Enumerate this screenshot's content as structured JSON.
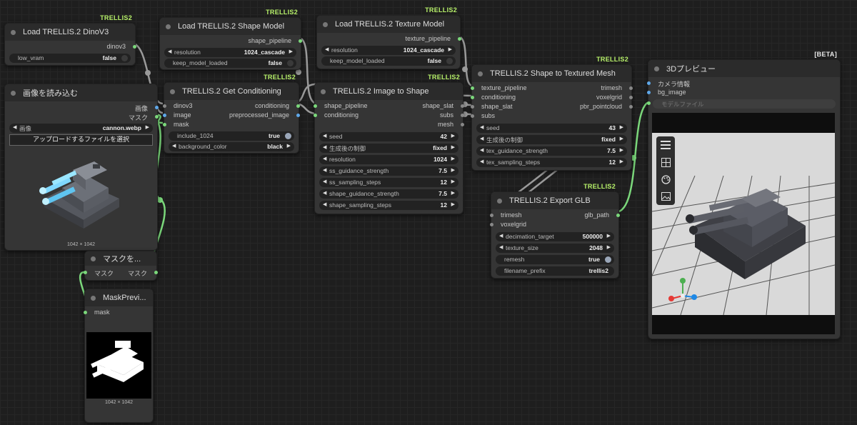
{
  "badges": {
    "trellis": "TRELLIS2",
    "beta": "[BETA]"
  },
  "nodes": {
    "dinov3": {
      "title": "Load TRELLIS.2 DinoV3",
      "output": "dinov3",
      "widget_label": "low_vram",
      "widget_value": "false"
    },
    "shape_model": {
      "title": "Load TRELLIS.2 Shape Model",
      "output": "shape_pipeline",
      "resolution_label": "resolution",
      "resolution_value": "1024_cascade",
      "keep_label": "keep_model_loaded",
      "keep_value": "false"
    },
    "texture_model": {
      "title": "Load TRELLIS.2 Texture Model",
      "output": "texture_pipeline",
      "resolution_label": "resolution",
      "resolution_value": "1024_cascade",
      "keep_label": "keep_model_loaded",
      "keep_value": "false"
    },
    "load_image": {
      "title": "画像を読み込む",
      "out_image": "画像",
      "out_mask": "マスク",
      "image_label": "画像",
      "image_value": "cannon.webp",
      "upload_label": "アップロードするファイルを選択",
      "caption": "1042 × 1042"
    },
    "conditioning": {
      "title": "TRELLIS.2 Get Conditioning",
      "in_dinov3": "dinov3",
      "in_image": "image",
      "in_mask": "mask",
      "out_conditioning": "conditioning",
      "out_preprocessed": "preprocessed_image",
      "include_label": "include_1024",
      "include_value": "true",
      "bg_label": "background_color",
      "bg_value": "black"
    },
    "image_to_shape": {
      "title": "TRELLIS.2 Image to Shape",
      "in_shape_pipeline": "shape_pipeline",
      "in_conditioning": "conditioning",
      "out_shape_slat": "shape_slat",
      "out_subs": "subs",
      "out_mesh": "mesh",
      "widgets": [
        {
          "label": "seed",
          "value": "42"
        },
        {
          "label": "生成後の制御",
          "value": "fixed"
        },
        {
          "label": "resolution",
          "value": "1024"
        },
        {
          "label": "ss_guidance_strength",
          "value": "7.5"
        },
        {
          "label": "ss_sampling_steps",
          "value": "12"
        },
        {
          "label": "shape_guidance_strength",
          "value": "7.5"
        },
        {
          "label": "shape_sampling_steps",
          "value": "12"
        }
      ]
    },
    "textured_mesh": {
      "title": "TRELLIS.2 Shape to Textured Mesh",
      "in_texture_pipeline": "texture_pipeline",
      "in_conditioning": "conditioning",
      "in_shape_slat": "shape_slat",
      "in_subs": "subs",
      "out_trimesh": "trimesh",
      "out_voxelgrid": "voxelgrid",
      "out_pbr": "pbr_pointcloud",
      "widgets": [
        {
          "label": "seed",
          "value": "43"
        },
        {
          "label": "生成後の制御",
          "value": "fixed"
        },
        {
          "label": "tex_guidance_strength",
          "value": "7.5"
        },
        {
          "label": "tex_sampling_steps",
          "value": "12"
        }
      ]
    },
    "export_glb": {
      "title": "TRELLIS.2 Export GLB",
      "in_trimesh": "trimesh",
      "in_voxelgrid": "voxelgrid",
      "out_glb_path": "glb_path",
      "decimation_label": "decimation_target",
      "decimation_value": "500000",
      "texture_label": "texture_size",
      "texture_value": "2048",
      "remesh_label": "remesh",
      "remesh_value": "true",
      "prefix_label": "filename_prefix",
      "prefix_value": "trellis2"
    },
    "preview3d": {
      "title": "3Dプレビュー",
      "in_camera": "カメラ情報",
      "in_bg": "bg_image",
      "model_file_placeholder": "モデルファイル"
    },
    "mask_node": {
      "title": "マスクを...",
      "in_mask": "マスク",
      "out_mask": "マスク"
    },
    "mask_preview": {
      "title": "MaskPrevi...",
      "in_mask": "mask",
      "caption": "1042 × 1042"
    }
  },
  "colors": {
    "canvas": "#1e1e1e",
    "node": "#353535",
    "badge": "#b8f26a",
    "wire_green": "#7bd87b",
    "wire_gray": "#9a9a9a",
    "port_blue": "#5fa8ea"
  },
  "icons": [
    "menu-icon",
    "grid-icon",
    "palette-icon",
    "image-icon"
  ]
}
